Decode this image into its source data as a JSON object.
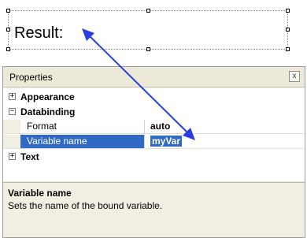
{
  "design_surface": {
    "label_text": "Result:"
  },
  "properties_panel": {
    "title": "Properties",
    "close_symbol": "x",
    "categories": [
      {
        "toggle": "+",
        "label": "Appearance"
      },
      {
        "toggle": "−",
        "label": "Databinding"
      },
      {
        "toggle": "+",
        "label": "Text"
      }
    ],
    "properties": [
      {
        "name": "Format",
        "value": "auto"
      },
      {
        "name": "Variable name",
        "value": "myVar"
      }
    ],
    "description": {
      "title": "Variable name",
      "text": "Sets the name of the bound variable."
    }
  },
  "colors": {
    "selection": "#316ac5",
    "arrow": "#2a3ee0",
    "panel_bg": "#f1efe2"
  }
}
